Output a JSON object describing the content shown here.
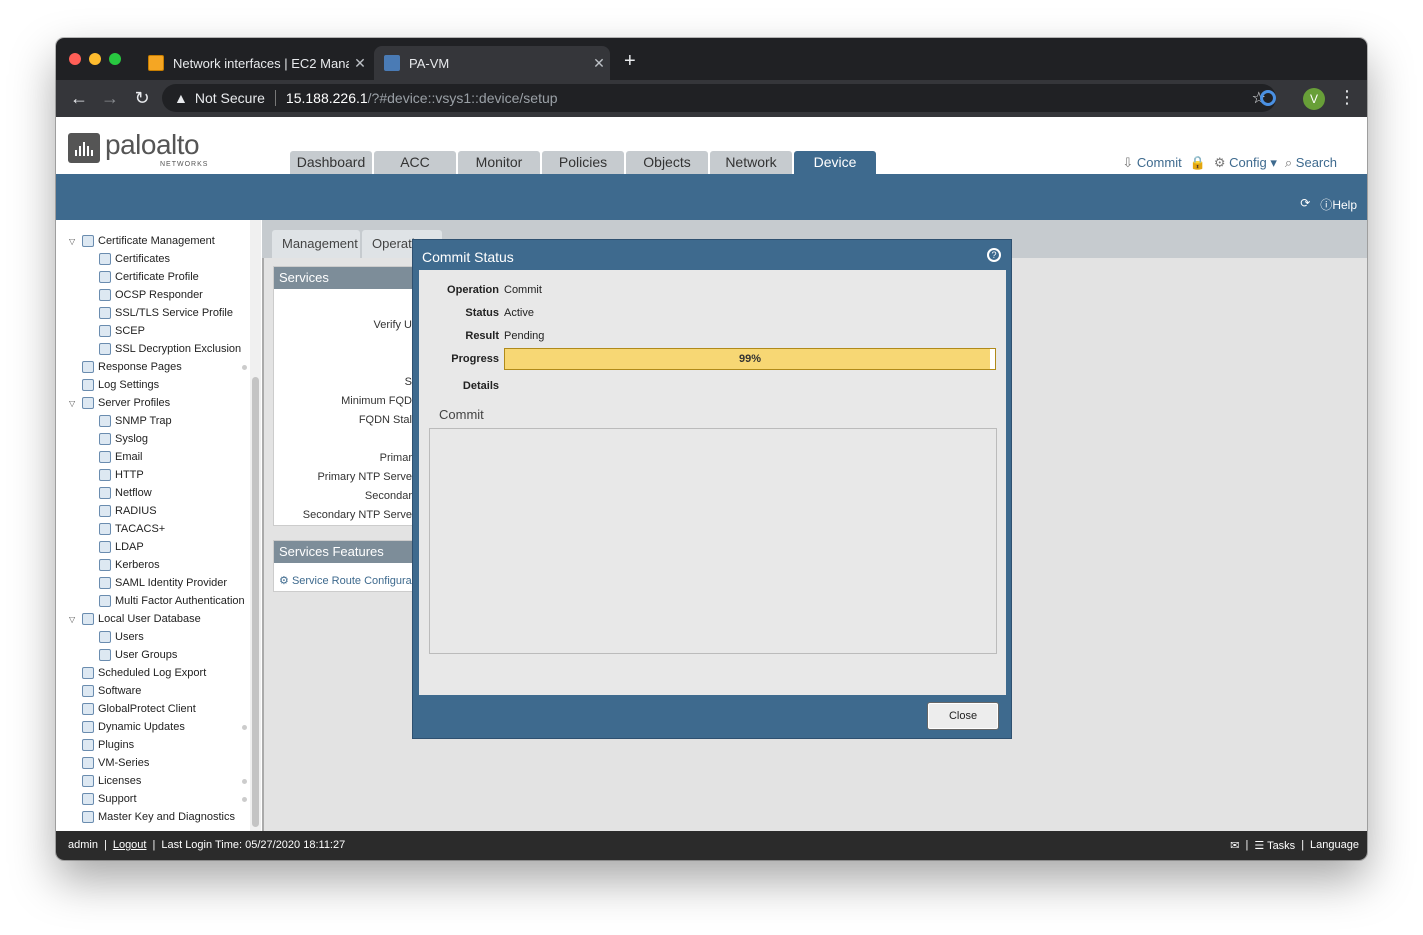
{
  "browser": {
    "tabs": [
      {
        "title": "Network interfaces | EC2 Mana",
        "favicon": "aws-cube-icon"
      },
      {
        "title": "PA-VM",
        "favicon": "paloalto-icon"
      }
    ],
    "security_label": "Not Secure",
    "url_host": "15.188.226.1",
    "url_path": "/?#device::vsys1::device/setup",
    "profile_initial": "V"
  },
  "header": {
    "logo_text": "paloalto",
    "logo_sub": "NETWORKS",
    "main_tabs": [
      "Dashboard",
      "ACC",
      "Monitor",
      "Policies",
      "Objects",
      "Network",
      "Device"
    ],
    "active_tab": "Device",
    "commit_label": "Commit",
    "config_label": "Config",
    "search_label": "Search",
    "help_label": "Help"
  },
  "sidebar": {
    "items": [
      {
        "label": "Certificate Management",
        "level": 0,
        "expanded": true
      },
      {
        "label": "Certificates",
        "level": 1
      },
      {
        "label": "Certificate Profile",
        "level": 1
      },
      {
        "label": "OCSP Responder",
        "level": 1
      },
      {
        "label": "SSL/TLS Service Profile",
        "level": 1
      },
      {
        "label": "SCEP",
        "level": 1
      },
      {
        "label": "SSL Decryption Exclusion",
        "level": 1
      },
      {
        "label": "Response Pages",
        "level": 0,
        "dot": true
      },
      {
        "label": "Log Settings",
        "level": 0
      },
      {
        "label": "Server Profiles",
        "level": 0,
        "expanded": true
      },
      {
        "label": "SNMP Trap",
        "level": 1
      },
      {
        "label": "Syslog",
        "level": 1
      },
      {
        "label": "Email",
        "level": 1
      },
      {
        "label": "HTTP",
        "level": 1
      },
      {
        "label": "Netflow",
        "level": 1
      },
      {
        "label": "RADIUS",
        "level": 1
      },
      {
        "label": "TACACS+",
        "level": 1
      },
      {
        "label": "LDAP",
        "level": 1
      },
      {
        "label": "Kerberos",
        "level": 1
      },
      {
        "label": "SAML Identity Provider",
        "level": 1
      },
      {
        "label": "Multi Factor Authentication",
        "level": 1
      },
      {
        "label": "Local User Database",
        "level": 0,
        "expanded": true
      },
      {
        "label": "Users",
        "level": 1
      },
      {
        "label": "User Groups",
        "level": 1
      },
      {
        "label": "Scheduled Log Export",
        "level": 0
      },
      {
        "label": "Software",
        "level": 0
      },
      {
        "label": "GlobalProtect Client",
        "level": 0
      },
      {
        "label": "Dynamic Updates",
        "level": 0,
        "dot": true
      },
      {
        "label": "Plugins",
        "level": 0
      },
      {
        "label": "VM-Series",
        "level": 0
      },
      {
        "label": "Licenses",
        "level": 0,
        "dot": true
      },
      {
        "label": "Support",
        "level": 0,
        "dot": true
      },
      {
        "label": "Master Key and Diagnostics",
        "level": 0
      }
    ]
  },
  "content": {
    "sub_tabs": [
      "Management",
      "Operati"
    ],
    "services_title": "Services",
    "services_labels": [
      "Verify U",
      "S",
      "Minimum FQD",
      "FQDN Stal",
      "Primar",
      "Primary NTP Serve",
      "Secondar",
      "Secondary NTP Serve"
    ],
    "features_title": "Services Features",
    "features_link": "Service Route Configura"
  },
  "modal": {
    "title": "Commit Status",
    "operation_label": "Operation",
    "operation_value": "Commit",
    "status_label": "Status",
    "status_value": "Active",
    "result_label": "Result",
    "result_value": "Pending",
    "progress_label": "Progress",
    "progress_text": "99%",
    "progress_fraction": 0.99,
    "details_label": "Details",
    "commit_tab": "Commit",
    "close_label": "Close"
  },
  "footer": {
    "user": "admin",
    "logout": "Logout",
    "last_login": "Last Login Time: 05/27/2020 18:11:27",
    "tasks": "Tasks",
    "language": "Language"
  },
  "colors": {
    "brand_blue": "#3e6a8e",
    "progress_fill": "#f7d774"
  }
}
